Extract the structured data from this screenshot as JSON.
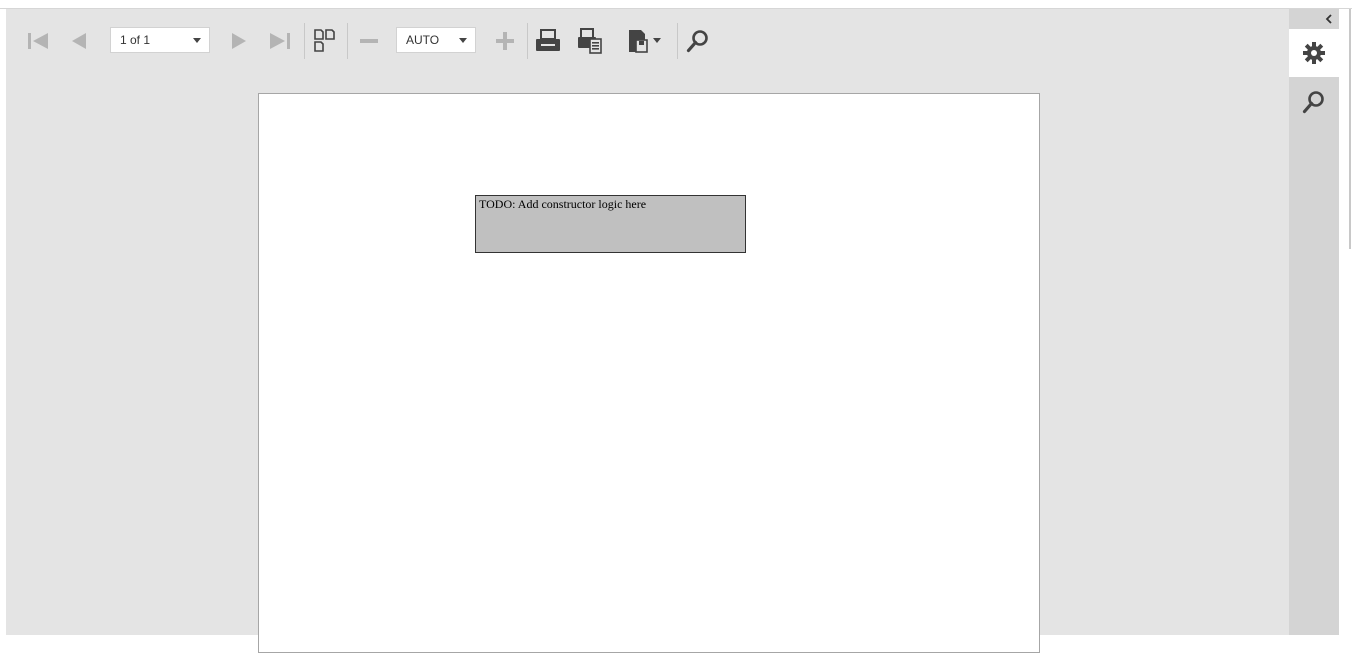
{
  "toolbar": {
    "page_selector": {
      "value": "1 of 1"
    },
    "zoom_selector": {
      "value": "AUTO"
    }
  },
  "report": {
    "textbox_text": "TODO: Add constructor logic here"
  },
  "sidebar": {
    "tabs": [
      {
        "icon": "gear-icon",
        "active": true
      },
      {
        "icon": "search-icon",
        "active": false
      }
    ]
  },
  "colors": {
    "viewer_bg": "#e4e4e4",
    "sidebar_bg": "#d4d4d4",
    "icon_disabled": "#b4b4b4",
    "icon_enabled": "#444444",
    "textbox_bg": "#c0c0c0"
  }
}
